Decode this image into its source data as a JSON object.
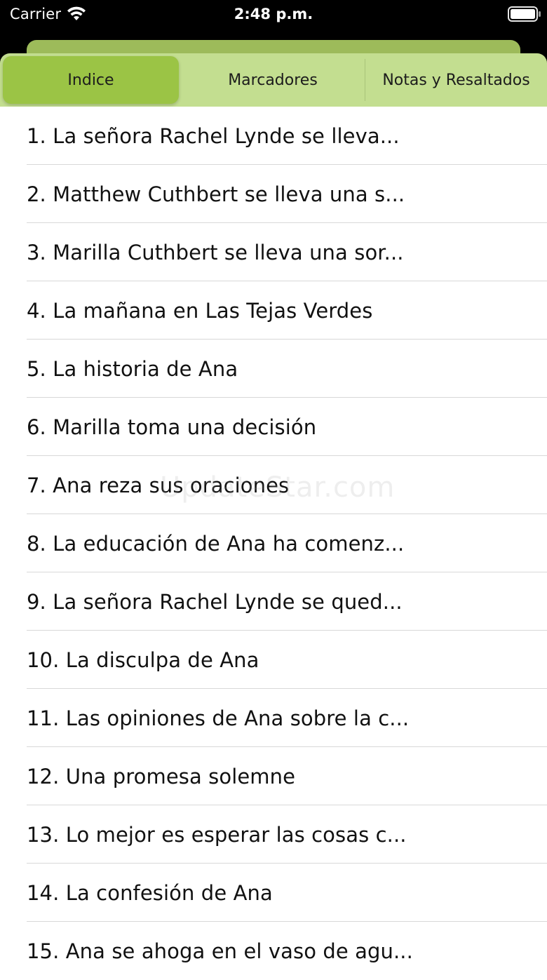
{
  "status_bar": {
    "carrier": "Carrier",
    "time": "2:48 p.m.",
    "wifi_icon": "wifi-icon",
    "battery_icon": "battery-icon"
  },
  "tabs": {
    "items": [
      {
        "label": "Indice",
        "selected": true
      },
      {
        "label": "Marcadores",
        "selected": false
      },
      {
        "label": "Notas y Resaltados",
        "selected": false
      }
    ]
  },
  "chapters": [
    "1. La señora Rachel Lynde se lleva...",
    "2. Matthew Cuthbert se lleva una s...",
    "3. Marilla Cuthbert se lleva una sor...",
    "4. La mañana en Las Tejas Verdes",
    "5. La historia de Ana",
    "6. Marilla toma una decisión",
    "7. Ana reza sus oraciones",
    "8. La educación de Ana ha comenz...",
    "9. La señora Rachel Lynde se qued...",
    "10. La disculpa de Ana",
    "11. Las opiniones de Ana sobre la c...",
    "12. Una promesa solemne",
    "13. Lo mejor es esperar las cosas c...",
    "14. La confesión de Ana",
    "15. Ana se ahoga en el vaso de agu..."
  ],
  "watermark": "UpdateStar.com",
  "colors": {
    "selected_tab": "#9bc445",
    "tab_bar": "#c3de90",
    "tab_back": "#9dbb5a"
  }
}
